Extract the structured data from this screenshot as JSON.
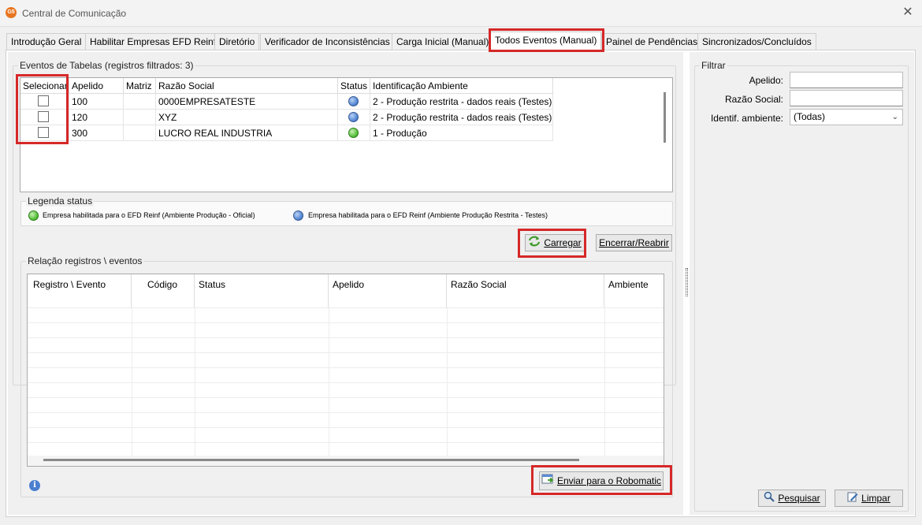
{
  "window": {
    "title": "Central de Comunicação",
    "logo_text": "G5"
  },
  "tabs": [
    {
      "label": "Introdução Geral"
    },
    {
      "label": "Habilitar Empresas EFD Reinf"
    },
    {
      "label": "Diretório"
    },
    {
      "label": "Verificador de Inconsistências"
    },
    {
      "label": "Carga Inicial (Manual)"
    },
    {
      "label": "Todos Eventos (Manual)"
    },
    {
      "label": "Painel de Pendências"
    },
    {
      "label": "Sincronizados/Concluídos"
    }
  ],
  "events_table": {
    "group_title": "Eventos de Tabelas (registros filtrados: 3)",
    "columns": [
      "Selecionar",
      "Apelido",
      "Matriz",
      "Razão Social",
      "Status",
      "Identificação Ambiente"
    ],
    "rows": [
      {
        "apelido": "100",
        "matriz": "",
        "razao": "0000EMPRESATESTE",
        "status": "blue",
        "ambiente": "2 - Produção restrita - dados reais (Testes)"
      },
      {
        "apelido": "120",
        "matriz": "",
        "razao": "XYZ",
        "status": "blue",
        "ambiente": "2 - Produção restrita - dados reais (Testes)"
      },
      {
        "apelido": "300",
        "matriz": "",
        "razao": "LUCRO REAL INDUSTRIA",
        "status": "green",
        "ambiente": "1 - Produção"
      }
    ]
  },
  "legend": {
    "title": "Legenda status",
    "items": [
      {
        "color": "green",
        "text": "Empresa habilitada para o EFD Reinf (Ambiente Produção - Oficial)"
      },
      {
        "color": "blue",
        "text": "Empresa habilitada para o EFD Reinf (Ambiente Produção Restrita - Testes)"
      }
    ]
  },
  "buttons": {
    "carregar": "Carregar",
    "encerrar": "Encerrar/Reabrir",
    "enviar": "Enviar para o Robomatic",
    "pesquisar": "Pesquisar",
    "limpar": "Limpar"
  },
  "relation": {
    "group_title": "Relação registros \\ eventos",
    "columns": [
      "Registro \\ Evento",
      "Código",
      "Status",
      "Apelido",
      "Razão Social",
      "Ambiente"
    ]
  },
  "filter": {
    "title": "Filtrar",
    "apelido_label": "Apelido:",
    "apelido_value": "",
    "razao_label": "Razão Social:",
    "razao_value": "",
    "ambiente_label": "Identif. ambiente:",
    "ambiente_value": "(Todas)"
  },
  "colors": {
    "highlight": "#d62828",
    "status_blue": "#4a7fd0",
    "status_green": "#4bbb2e"
  }
}
